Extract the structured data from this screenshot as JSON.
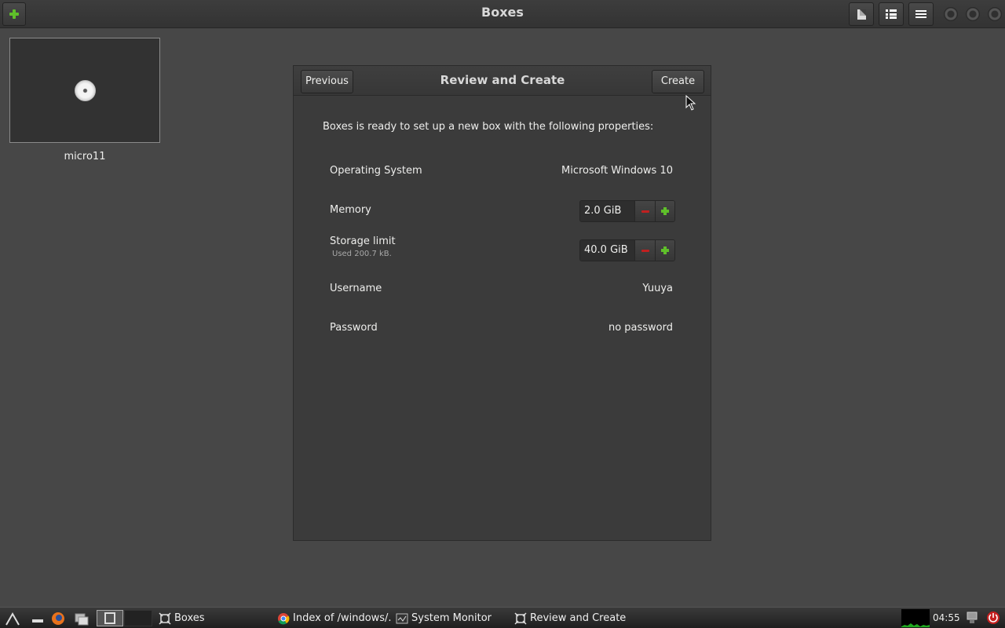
{
  "window": {
    "title": "Boxes"
  },
  "header": {
    "new_button_icon": "plus-icon",
    "buttons": [
      "document-icon",
      "list-view-icon",
      "menu-icon"
    ]
  },
  "collection": {
    "items": [
      {
        "name": "micro11",
        "icon": "cd-disc-icon"
      }
    ]
  },
  "dialog": {
    "title": "Review and Create",
    "previous_label": "Previous",
    "create_label": "Create",
    "intro": "Boxes is ready to set up a new box with the following properties:",
    "properties": {
      "os_label": "Operating System",
      "os_value": "Microsoft Windows 10",
      "memory_label": "Memory",
      "memory_value": "2.0 GiB",
      "storage_label": "Storage limit",
      "storage_sub": "Used 200.7 kB.",
      "storage_value": "40.0 GiB",
      "username_label": "Username",
      "username_value": "Yuuya",
      "password_label": "Password",
      "password_value": "no password"
    }
  },
  "taskbar": {
    "tasks": [
      {
        "label": "Boxes",
        "icon": "boxes-icon"
      },
      {
        "label": "Index of /windows/...",
        "icon": "chrome-icon"
      },
      {
        "label": "System Monitor",
        "icon": "system-monitor-icon"
      },
      {
        "label": "Review and Create",
        "icon": "boxes-icon"
      }
    ],
    "clock": "04:55"
  },
  "colors": {
    "accent_green": "#5fbf2a",
    "minus_red": "#c02020",
    "background": "#474747"
  }
}
